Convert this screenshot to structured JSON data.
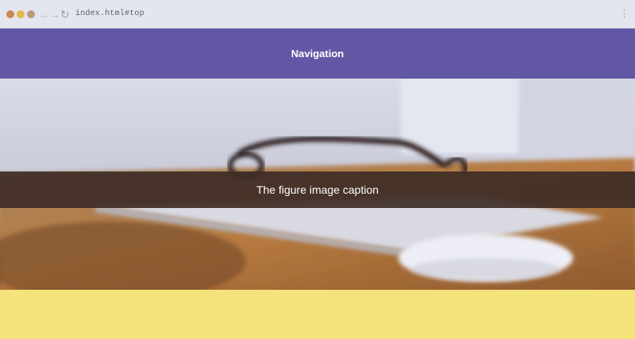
{
  "browser": {
    "address": "index.html#top",
    "icons": [
      "back-arrow-icon",
      "forward-arrow-icon",
      "reload-icon",
      "kebab-menu-icon"
    ]
  },
  "navbar": {
    "title": "Navigation",
    "background": "#6257a4"
  },
  "figure": {
    "caption": "The figure image caption"
  },
  "content": {
    "background": "#f4e27a"
  }
}
